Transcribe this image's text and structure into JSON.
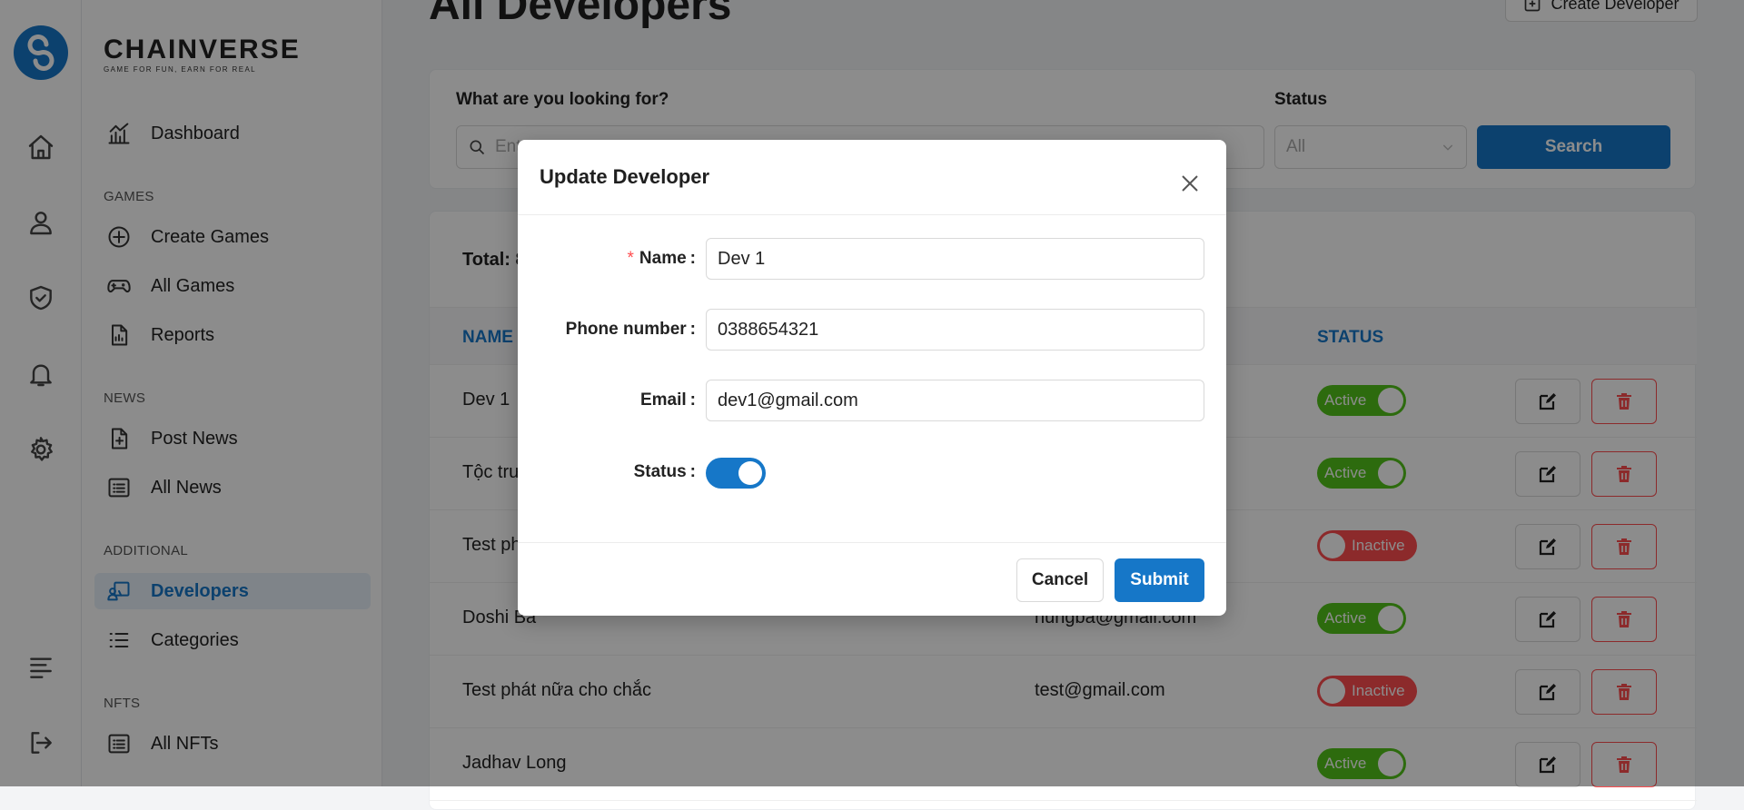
{
  "brand": {
    "name": "CHAINVERSE",
    "tagline": "GAME FOR FUN, EARN FOR REAL",
    "logo_letter": "S"
  },
  "rail": {
    "icons": [
      "home-icon",
      "user-icon",
      "shield-check-icon",
      "bell-icon",
      "gear-icon",
      "menu-icon",
      "logout-icon"
    ]
  },
  "sidebar": {
    "dashboard": "Dashboard",
    "sections": {
      "games": "GAMES",
      "news": "NEWS",
      "additional": "ADDITIONAL",
      "nfts": "NFTS"
    },
    "items": {
      "create_games": "Create Games",
      "all_games": "All Games",
      "reports": "Reports",
      "post_news": "Post News",
      "all_news": "All News",
      "developers": "Developers",
      "categories": "Categories",
      "all_nfts": "All NFTs"
    }
  },
  "main": {
    "title": "All Developers",
    "create_button": "Create Developer",
    "filter": {
      "search_label": "What are you looking for?",
      "search_placeholder": "Enter name",
      "status_label": "Status",
      "status_value": "All",
      "search_button": "Search"
    },
    "total_label": "Total: 8",
    "columns": {
      "name": "NAME",
      "status": "STATUS"
    },
    "rows": [
      {
        "name": "Dev 1",
        "email": "",
        "status": "Active"
      },
      {
        "name": "Tộc trưởng",
        "email": "",
        "status": "Active"
      },
      {
        "name": "Test phát",
        "email": "",
        "status": "Inactive"
      },
      {
        "name": "Doshi Ba",
        "email": "hungba@gmail.com",
        "status": "Active"
      },
      {
        "name": "Test phát nữa cho chắc",
        "email": "test@gmail.com",
        "status": "Inactive"
      },
      {
        "name": "Jadhav Long",
        "email": "",
        "status": "Active"
      }
    ],
    "colors": {
      "primary": "#1677c8",
      "active": "#52c41a",
      "inactive": "#ff4d4f"
    }
  },
  "modal": {
    "title": "Update Developer",
    "fields": {
      "name_label": "Name",
      "name_value": "Dev 1",
      "phone_label": "Phone number",
      "phone_value": "0388654321",
      "email_label": "Email",
      "email_value": "dev1@gmail.com",
      "status_label": "Status",
      "status_on": true
    },
    "cancel": "Cancel",
    "submit": "Submit"
  }
}
